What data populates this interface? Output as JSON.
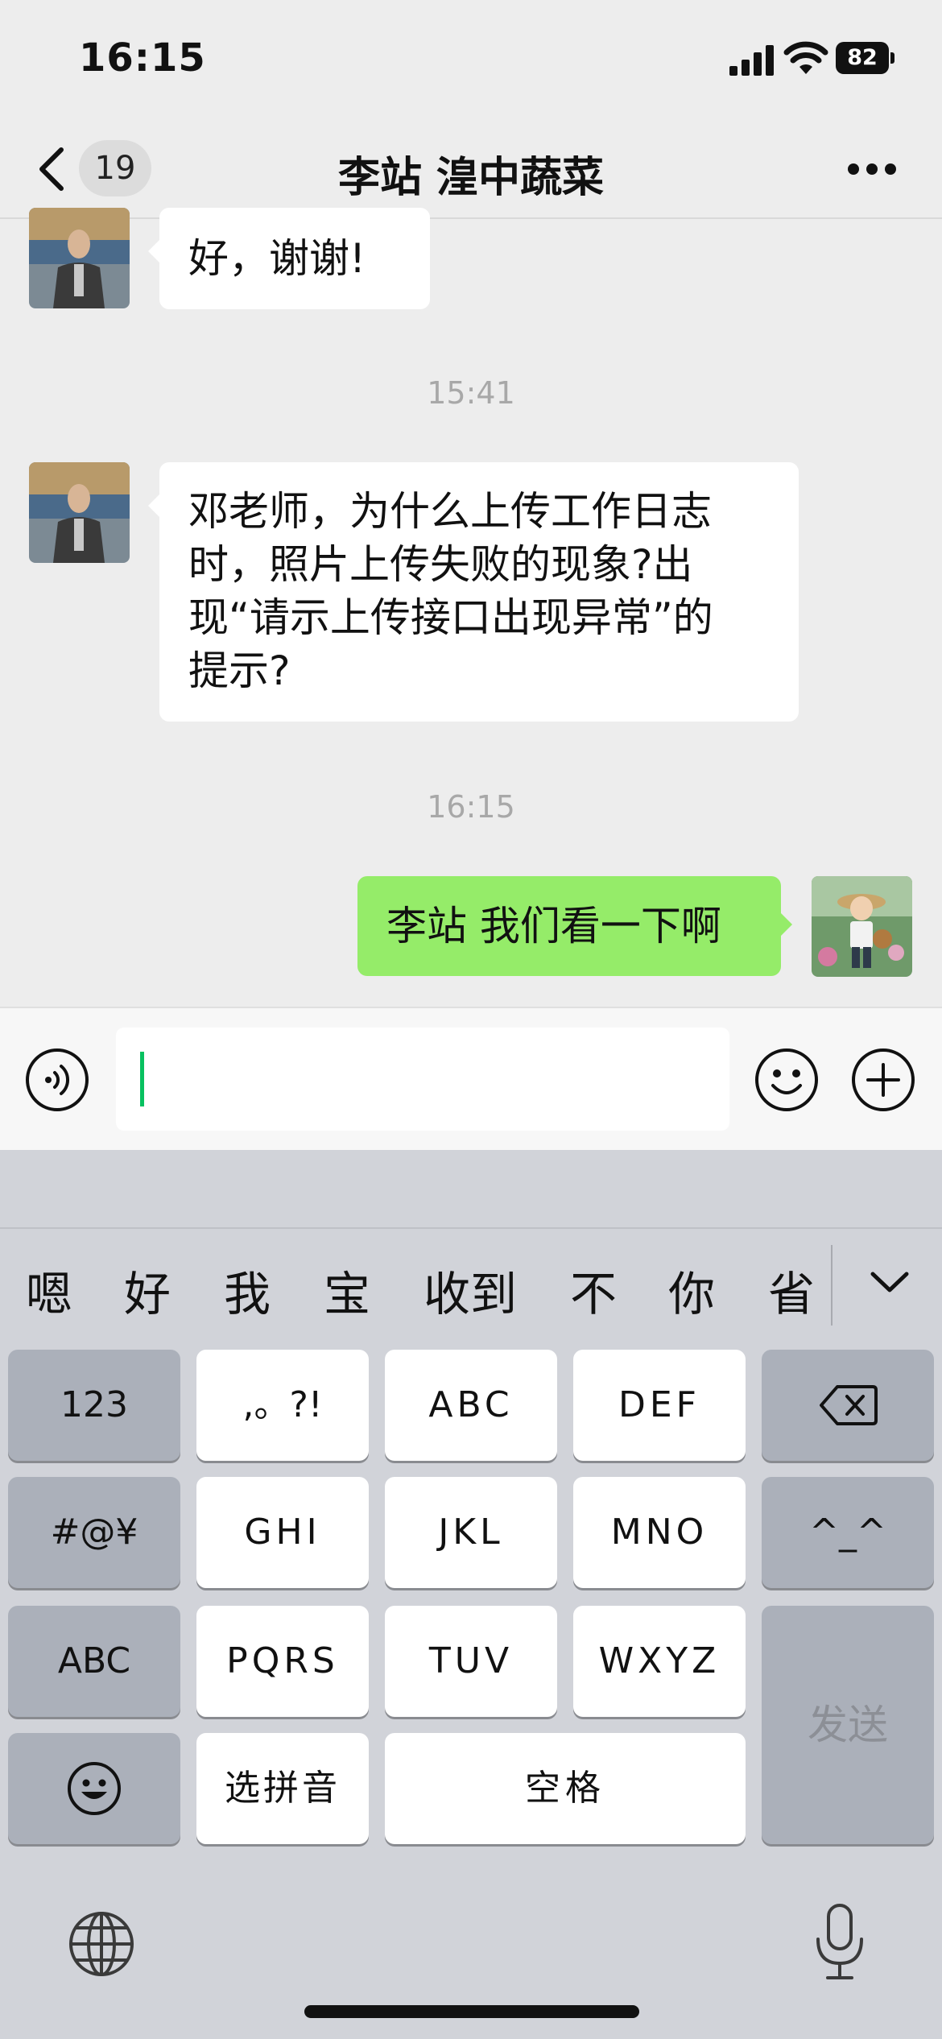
{
  "status_bar": {
    "time": "16:15",
    "battery": "82"
  },
  "nav": {
    "unread_count": "19",
    "title": "李站 湟中蔬菜"
  },
  "messages": [
    {
      "side": "in",
      "text": "好，谢谢!"
    },
    {
      "type": "time",
      "text": "15:41"
    },
    {
      "side": "in",
      "lines": [
        "邓老师，为什么上传工作日志",
        "时，照片上传失败的现象?出",
        "现“请示上传接口出现异常”的",
        "提示?"
      ]
    },
    {
      "type": "time",
      "text": "16:15"
    },
    {
      "side": "out",
      "text": "李站 我们看一下啊"
    }
  ],
  "input": {
    "value": ""
  },
  "keyboard": {
    "candidates": [
      "嗯",
      "好",
      "我",
      "宝",
      "收到",
      "不",
      "你",
      "省"
    ],
    "rows": [
      [
        "123",
        ",。?!",
        "ABC",
        "DEF"
      ],
      [
        "#@¥",
        "GHI",
        "JKL",
        "MNO",
        "^_^"
      ],
      [
        "ABC",
        "PQRS",
        "TUV",
        "WXYZ"
      ],
      [
        "选拼音",
        "空格"
      ]
    ],
    "send": "发送"
  },
  "colors": {
    "accent_green": "#07c160",
    "bubble_out": "#95ec69",
    "background": "#ededed"
  },
  "icons": [
    "signal-icon",
    "wifi-icon",
    "battery-icon",
    "back-chevron-icon",
    "more-icon",
    "voice-icon",
    "emoji-icon",
    "plus-icon",
    "collapse-chevron-icon",
    "delete-icon",
    "emoji-key-icon",
    "globe-icon",
    "microphone-icon"
  ]
}
